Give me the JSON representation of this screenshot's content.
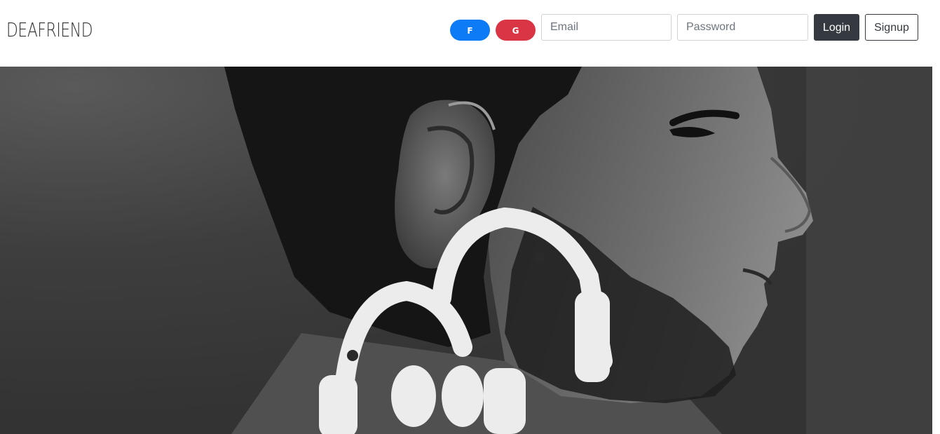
{
  "navbar": {
    "brand": "DEAFRIEND",
    "facebook_label": "F",
    "google_label": "G",
    "email_placeholder": "Email",
    "password_placeholder": "Password",
    "login_label": "Login",
    "signup_label": "Signup"
  },
  "colors": {
    "facebook": "#0d7bf6",
    "google": "#d93545",
    "login_bg": "#343a40"
  },
  "hero": {
    "image": "man-with-hearing-aid-headphones-logo",
    "icon": "headphones-icon"
  }
}
